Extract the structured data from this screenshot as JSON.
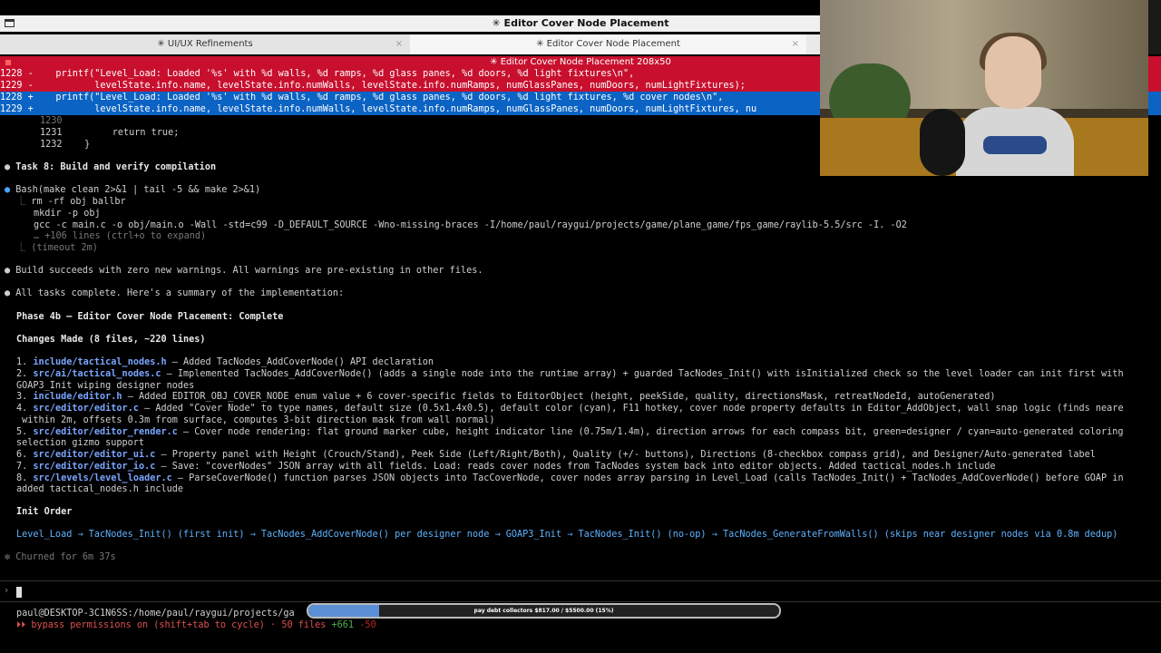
{
  "window": {
    "title": "✳ Editor Cover Node Placement",
    "tabs": [
      {
        "label": "✳ UI/UX Refinements",
        "close": "×"
      },
      {
        "label": "✳ Editor Cover Node Placement",
        "close": "×"
      }
    ],
    "pane_header": "✳ Editor Cover Node Placement 208x50"
  },
  "diff": {
    "lines": [
      {
        "type": "del",
        "text": "1228 -    printf(\"Level_Load: Loaded '%s' with %d walls, %d ramps, %d glass panes, %d doors, %d light fixtures\\n\","
      },
      {
        "type": "del",
        "text": "1229 -           levelState.info.name, levelState.info.numWalls, levelState.info.numRamps, numGlassPanes, numDoors, numLightFixtures);"
      },
      {
        "type": "add",
        "text": "1228 +    printf(\"Level_Load: Loaded '%s' with %d walls, %d ramps, %d glass panes, %d doors, %d light fixtures, %d cover nodes\\n\","
      },
      {
        "type": "add",
        "text": "1229 +           levelState.info.name, levelState.info.numWalls, levelState.info.numRamps, numGlassPanes, numDoors, numLightFixtures, nu"
      },
      {
        "type": "ctx",
        "text": "1230"
      },
      {
        "type": "ctx",
        "text": "1231         return true;"
      },
      {
        "type": "ctx",
        "text": "1232    }"
      }
    ]
  },
  "transcript": {
    "task8": "Task 8: Build and verify compilation",
    "bash_cmd": "Bash(make clean 2>&1 | tail -5 && make 2>&1)",
    "bash_out": [
      "rm -rf obj ballbr",
      "mkdir -p obj",
      "gcc -c main.c -o obj/main.o -Wall -std=c99 -D_DEFAULT_SOURCE -Wno-missing-braces -I/home/paul/raygui/projects/game/plane_game/fps_game/raylib-5.5/src -I. -O2"
    ],
    "expand_hint": "… +106 lines (ctrl+o to expand)",
    "timeout": "(timeout 2m)",
    "build_msg": "Build succeeds with zero new warnings. All warnings are pre-existing in other files.",
    "summary_msg": "All tasks complete. Here's a summary of the implementation:",
    "phase_title": "Phase 4b — Editor Cover Node Placement: Complete",
    "changes_title": "Changes Made (8 files, ~220 lines)",
    "changes": [
      {
        "n": "1.",
        "path": "include/tactical_nodes.h",
        "desc": " — Added TacNodes_AddCoverNode() API declaration"
      },
      {
        "n": "2.",
        "path": "src/ai/tactical_nodes.c",
        "desc": " — Implemented TacNodes_AddCoverNode() (adds a single node into the runtime array) + guarded TacNodes_Init() with isInitialized check so the level loader can init first with"
      },
      {
        "n": "",
        "path": "",
        "desc": "GOAP3_Init wiping designer nodes"
      },
      {
        "n": "3.",
        "path": "include/editor.h",
        "desc": " — Added EDITOR_OBJ_COVER_NODE enum value + 6 cover-specific fields to EditorObject (height, peekSide, quality, directionsMask, retreatNodeId, autoGenerated)"
      },
      {
        "n": "4.",
        "path": "src/editor/editor.c",
        "desc": " — Added \"Cover Node\" to type names, default size (0.5x1.4x0.5), default color (cyan), F11 hotkey, cover node property defaults in Editor_AddObject, wall snap logic (finds neare"
      },
      {
        "n": "",
        "path": "",
        "desc": " within 2m, offsets 0.3m from surface, computes 3-bit direction mask from wall normal)"
      },
      {
        "n": "5.",
        "path": "src/editor/editor_render.c",
        "desc": " — Cover node rendering: flat ground marker cube, height indicator line (0.75m/1.4m), direction arrows for each compass bit, green=designer / cyan=auto-generated coloring"
      },
      {
        "n": "",
        "path": "",
        "desc": "selection gizmo support"
      },
      {
        "n": "6.",
        "path": "src/editor/editor_ui.c",
        "desc": " — Property panel with Height (Crouch/Stand), Peek Side (Left/Right/Both), Quality (+/- buttons), Directions (8-checkbox compass grid), and Designer/Auto-generated label"
      },
      {
        "n": "7.",
        "path": "src/editor/editor_io.c",
        "desc": " — Save: \"coverNodes\" JSON array with all fields. Load: reads cover nodes from TacNodes system back into editor objects. Added tactical_nodes.h include"
      },
      {
        "n": "8.",
        "path": "src/levels/level_loader.c",
        "desc": " — ParseCoverNode() function parses JSON objects into TacCoverNode, cover nodes array parsing in Level_Load (calls TacNodes_Init() + TacNodes_AddCoverNode() before GOAP in"
      },
      {
        "n": "",
        "path": "",
        "desc": "added tactical_nodes.h include"
      }
    ],
    "init_title": "Init Order",
    "init_line": "Level_Load → TacNodes_Init() (first init) → TacNodes_AddCoverNode() per designer node → GOAP3_Init → TacNodes_Init() (no-op) → TacNodes_GenerateFromWalls() (skips near designer nodes via 0.8m dedup)",
    "churned": "✻ Churned for 6m 37s"
  },
  "prompt": {
    "symbol": "›"
  },
  "status": {
    "line1": "paul@DESKTOP-3C1N6SS:/home/paul/raygui/projects/ga",
    "line2_prefix": "⏵⏵ bypass permissions on (shift+tab to cycle) · 50 files ",
    "added": "+661",
    "removed": "-50"
  },
  "donation": {
    "label": "pay debt collectors $817.00 / $5500.00 (15%)",
    "percent": 15
  },
  "colors": {
    "deleted_bg": "#c8102e",
    "added_bg": "#0b63c4",
    "link": "#5fb3ff"
  },
  "icons": [
    "window-icon",
    "close-icon",
    "bullet-icon",
    "tree-icon"
  ]
}
